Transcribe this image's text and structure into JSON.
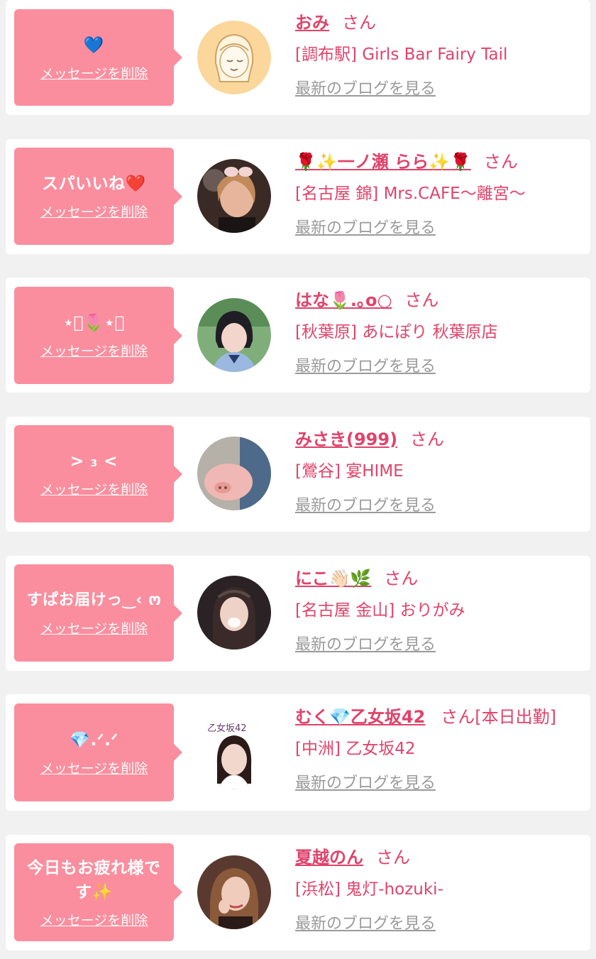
{
  "messages": [
    {
      "message": "💙",
      "delete_label": "メッセージを削除",
      "name": "おみ",
      "honorific": "さん",
      "shop": "[調布駅] Girls Bar Fairy Tail",
      "blog_link": "最新のブログを見る",
      "avatar": "illustration-avatar"
    },
    {
      "message": "スパいいね❤️",
      "delete_label": "メッセージを削除",
      "name": "🌹✨一ノ瀬 らら✨🌹",
      "honorific": "さん",
      "shop": "[名古屋 錦] Mrs.CAFE〜離宮〜",
      "blog_link": "最新のブログを見る",
      "avatar": "photo-avatar"
    },
    {
      "message": "⋆͛🌷⋆͛",
      "delete_label": "メッセージを削除",
      "name": "はな🌷.｡o○",
      "honorific": "さん",
      "shop": "[秋葉原] あにぽり 秋葉原店",
      "blog_link": "最新のブログを見る",
      "avatar": "photo-avatar"
    },
    {
      "message": "> ₃ <",
      "delete_label": "メッセージを削除",
      "name": "みさき(999)",
      "honorific": "さん",
      "shop": "[鶯谷] 宴HIME",
      "blog_link": "最新のブログを見る",
      "avatar": "photo-avatar"
    },
    {
      "message": "すぱお届けっ‿‹ ო",
      "delete_label": "メッセージを削除",
      "name": "にこ👋🏻🌿",
      "honorific": "さん",
      "shop": "[名古屋 金山] おりがみ",
      "blog_link": "最新のブログを見る",
      "avatar": "photo-avatar"
    },
    {
      "message": "💎.ᐟ.ᐟ",
      "delete_label": "メッセージを削除",
      "name": "むく💎乙女坂42",
      "honorific": "さん[本日出勤]",
      "shop": "[中洲] 乙女坂42",
      "blog_link": "最新のブログを見る",
      "avatar": "photo-avatar",
      "avatar_caption": "乙女坂42"
    },
    {
      "message": "今日もお疲れ様です✨",
      "delete_label": "メッセージを削除",
      "name": "夏越のん",
      "honorific": "さん",
      "shop": "[浜松] 鬼灯-hozuki-",
      "blog_link": "最新のブログを見る",
      "avatar": "photo-avatar"
    }
  ],
  "colors": {
    "accent": "#e0436a",
    "bubble": "#fa8e9e",
    "muted": "#9a9a9a"
  }
}
